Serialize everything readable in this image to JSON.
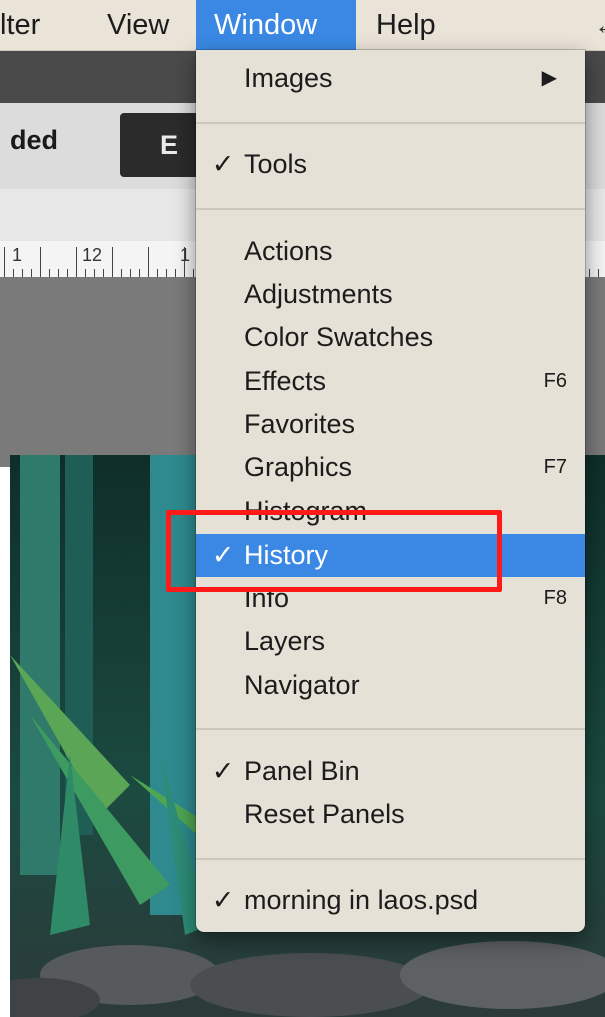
{
  "menubar": {
    "items": [
      {
        "label": "lter"
      },
      {
        "label": "View"
      },
      {
        "label": "Window"
      },
      {
        "label": "Help"
      }
    ],
    "edge_glyph": "↔"
  },
  "options_bar": {
    "mode_text": "ded",
    "button_text": "E"
  },
  "ruler": {
    "labels": [
      "1",
      "12",
      "1"
    ]
  },
  "window_menu": {
    "items": [
      {
        "label": "Images",
        "submenu_arrow": "▶"
      },
      {
        "label": "Tools",
        "checked": true,
        "check": "✓"
      },
      {
        "label": "Actions"
      },
      {
        "label": "Adjustments"
      },
      {
        "label": "Color Swatches"
      },
      {
        "label": "Effects",
        "shortcut": "F6"
      },
      {
        "label": "Favorites"
      },
      {
        "label": "Graphics",
        "shortcut": "F7"
      },
      {
        "label": "Histogram"
      },
      {
        "label": "History",
        "checked": true,
        "check": "✓",
        "selected": true
      },
      {
        "label": "Info",
        "shortcut": "F8"
      },
      {
        "label": "Layers"
      },
      {
        "label": "Navigator"
      },
      {
        "label": "Panel Bin",
        "checked": true,
        "check": "✓"
      },
      {
        "label": "Reset Panels"
      },
      {
        "label": "morning in laos.psd",
        "checked": true,
        "check": "✓"
      }
    ]
  },
  "colors": {
    "menu_bg": "#e6e1d6",
    "selection": "#3a88e3",
    "highlight_box": "#ff1a1a"
  }
}
